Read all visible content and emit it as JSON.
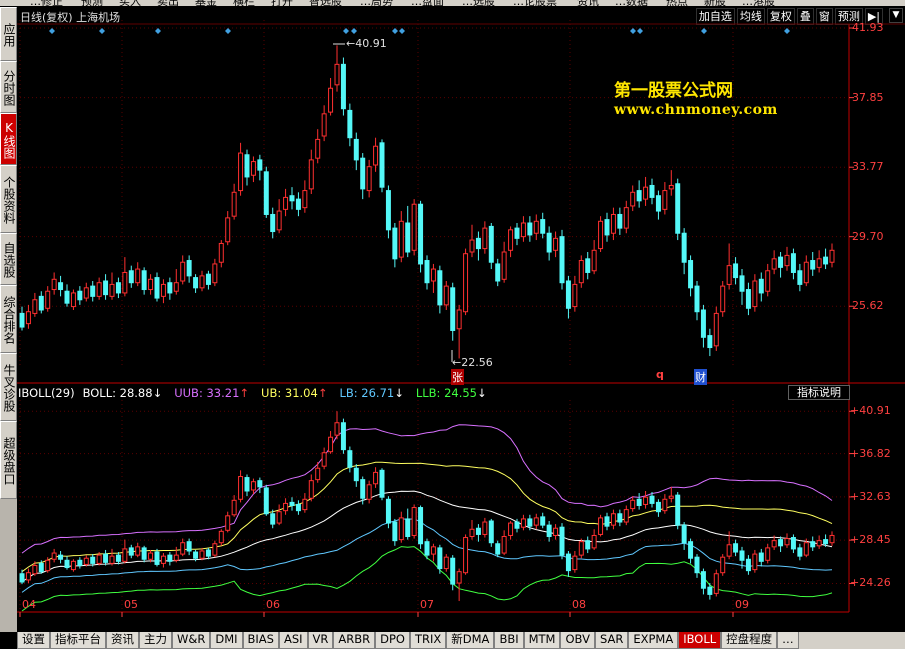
{
  "window": {
    "menu_fragments": [
      "…修正",
      "预测",
      "买入",
      "卖出",
      "基金",
      "横栏",
      "打开",
      "智选股",
      "…局势",
      "…盘面",
      "…选股",
      "…论股票",
      "资讯",
      "…数据",
      "热点",
      "新股",
      "…港股"
    ]
  },
  "left_nav": [
    {
      "label": "应用",
      "active": false
    },
    {
      "label": "分时图",
      "active": false
    },
    {
      "label": "K线图",
      "active": true
    },
    {
      "label": "个股资料",
      "active": false
    },
    {
      "label": "自选股",
      "active": false
    },
    {
      "label": "综合排名",
      "active": false
    },
    {
      "label": "牛叉诊股",
      "active": false
    },
    {
      "label": "超级盘口",
      "active": false
    }
  ],
  "header": {
    "title": "日线(复权) 上海机场",
    "buttons": [
      "加自选",
      "均线",
      "复权",
      "叠",
      "窗",
      "预测"
    ],
    "arrow_icon": "collapse-right-icon",
    "dropdown_icon": "chevron-down-icon"
  },
  "watermark": {
    "line1": "第一股票公式网",
    "line2": "www.chnmoney.com"
  },
  "price_axis": [
    "41.93",
    "37.85",
    "33.77",
    "29.70",
    "25.62"
  ],
  "indicator_axis": [
    "40.91",
    "36.82",
    "32.63",
    "28.45",
    "24.26"
  ],
  "time_axis": [
    "04",
    "05",
    "06",
    "07",
    "08",
    "09"
  ],
  "annotations": {
    "high_label": "40.91",
    "low_label": "22.56",
    "marker_zhang": "张",
    "marker_q": "q",
    "marker_cai": "财"
  },
  "indicator": {
    "name": "IBOLL(29)",
    "items": [
      {
        "label": "BOLL: 28.88",
        "arrow": "↓",
        "color": "#ffffff",
        "arrow_color": "#ffffff"
      },
      {
        "label": "UUB: 33.21",
        "arrow": "↑",
        "color": "#d870ff",
        "arrow_color": "#ff4040"
      },
      {
        "label": "UB: 31.04",
        "arrow": "↑",
        "color": "#ffff60",
        "arrow_color": "#ff4040"
      },
      {
        "label": "LB: 26.71",
        "arrow": "↓",
        "color": "#60c8ff",
        "arrow_color": "#ffffff"
      },
      {
        "label": "LLB: 24.55",
        "arrow": "↓",
        "color": "#40ff40",
        "arrow_color": "#ffffff"
      }
    ],
    "help_button": "指标说明"
  },
  "tabs": [
    {
      "label": "设置",
      "active": false
    },
    {
      "label": "指标平台",
      "active": false
    },
    {
      "label": "资讯",
      "active": false
    },
    {
      "label": "主力",
      "active": false
    },
    {
      "label": "W&R",
      "active": false
    },
    {
      "label": "DMI",
      "active": false
    },
    {
      "label": "BIAS",
      "active": false
    },
    {
      "label": "ASI",
      "active": false
    },
    {
      "label": "VR",
      "active": false
    },
    {
      "label": "ARBR",
      "active": false
    },
    {
      "label": "DPO",
      "active": false
    },
    {
      "label": "TRIX",
      "active": false
    },
    {
      "label": "新DMA",
      "active": false
    },
    {
      "label": "BBI",
      "active": false
    },
    {
      "label": "MTM",
      "active": false
    },
    {
      "label": "OBV",
      "active": false
    },
    {
      "label": "SAR",
      "active": false
    },
    {
      "label": "EXPMA",
      "active": false
    },
    {
      "label": "IBOLL",
      "active": true
    },
    {
      "label": "控盘程度",
      "active": false
    },
    {
      "label": "…",
      "active": false
    }
  ],
  "chart_data": {
    "type": "candlestick",
    "title": "日线(复权) 上海机场",
    "y_range_upper": [
      22.0,
      42.4
    ],
    "y_range_lower": [
      21.5,
      42.0
    ],
    "x_labels": [
      "04",
      "05",
      "06",
      "07",
      "08",
      "09"
    ],
    "candles": [
      [
        25.2,
        24.4,
        25.6,
        24.2
      ],
      [
        24.6,
        25.3,
        25.7,
        24.3
      ],
      [
        25.2,
        26.0,
        26.4,
        25.0
      ],
      [
        26.2,
        25.4,
        26.5,
        25.2
      ],
      [
        25.5,
        26.5,
        26.8,
        25.3
      ],
      [
        26.6,
        27.2,
        27.6,
        26.3
      ],
      [
        27.0,
        26.6,
        27.4,
        26.2
      ],
      [
        26.5,
        25.8,
        26.9,
        25.6
      ],
      [
        25.6,
        26.4,
        26.6,
        25.4
      ],
      [
        26.5,
        26.0,
        26.8,
        25.7
      ],
      [
        26.1,
        26.7,
        27.0,
        25.9
      ],
      [
        26.8,
        26.2,
        27.1,
        25.9
      ],
      [
        26.2,
        27.0,
        27.3,
        26.0
      ],
      [
        27.1,
        26.3,
        27.5,
        26.0
      ],
      [
        26.2,
        26.9,
        27.6,
        26.0
      ],
      [
        27.0,
        26.4,
        27.3,
        26.1
      ],
      [
        26.4,
        27.6,
        28.5,
        26.2
      ],
      [
        27.7,
        27.0,
        28.0,
        26.7
      ],
      [
        27.0,
        27.8,
        28.2,
        26.8
      ],
      [
        27.7,
        26.6,
        27.9,
        26.3
      ],
      [
        26.6,
        27.2,
        27.5,
        26.3
      ],
      [
        27.3,
        26.1,
        27.6,
        25.9
      ],
      [
        26.2,
        26.9,
        27.2,
        25.8
      ],
      [
        27.0,
        26.4,
        27.3,
        26.0
      ],
      [
        26.5,
        27.0,
        27.8,
        26.3
      ],
      [
        27.1,
        28.2,
        28.6,
        26.9
      ],
      [
        28.3,
        27.4,
        28.6,
        27.0
      ],
      [
        27.3,
        26.7,
        27.5,
        26.4
      ],
      [
        26.7,
        27.4,
        27.7,
        26.5
      ],
      [
        27.5,
        26.9,
        27.7,
        26.6
      ],
      [
        27.0,
        28.1,
        28.4,
        26.8
      ],
      [
        28.2,
        29.3,
        29.5,
        27.9
      ],
      [
        29.4,
        30.8,
        31.2,
        29.2
      ],
      [
        30.9,
        32.3,
        32.8,
        30.7
      ],
      [
        32.4,
        34.6,
        35.2,
        32.1
      ],
      [
        34.5,
        33.2,
        34.8,
        32.7
      ],
      [
        33.3,
        34.1,
        34.4,
        32.9
      ],
      [
        34.2,
        33.6,
        34.5,
        33.0
      ],
      [
        33.5,
        31.0,
        33.8,
        30.8
      ],
      [
        31.0,
        30.0,
        31.4,
        29.6
      ],
      [
        30.1,
        31.2,
        31.9,
        29.9
      ],
      [
        31.3,
        32.0,
        32.5,
        30.9
      ],
      [
        32.1,
        31.8,
        32.6,
        31.3
      ],
      [
        31.9,
        31.3,
        32.3,
        30.9
      ],
      [
        31.4,
        32.4,
        33.0,
        31.1
      ],
      [
        32.5,
        34.2,
        34.8,
        32.2
      ],
      [
        34.3,
        35.4,
        36.0,
        34.0
      ],
      [
        35.6,
        36.9,
        37.4,
        35.3
      ],
      [
        37.0,
        38.4,
        39.0,
        36.8
      ],
      [
        38.6,
        39.8,
        40.91,
        38.2
      ],
      [
        39.8,
        37.2,
        40.2,
        36.8
      ],
      [
        37.1,
        35.5,
        37.5,
        35.0
      ],
      [
        35.4,
        34.2,
        35.8,
        33.6
      ],
      [
        34.3,
        32.5,
        34.6,
        31.9
      ],
      [
        32.4,
        33.8,
        34.2,
        32.0
      ],
      [
        33.9,
        35.0,
        35.5,
        33.5
      ],
      [
        35.2,
        32.6,
        35.4,
        32.3
      ],
      [
        32.4,
        30.1,
        32.7,
        29.6
      ],
      [
        30.2,
        28.4,
        30.5,
        27.9
      ],
      [
        28.5,
        30.6,
        31.2,
        28.2
      ],
      [
        30.5,
        28.8,
        31.5,
        28.5
      ],
      [
        28.9,
        31.6,
        31.9,
        28.6
      ],
      [
        31.6,
        28.1,
        31.8,
        27.6
      ],
      [
        28.3,
        27.0,
        28.6,
        26.6
      ],
      [
        27.1,
        27.8,
        28.1,
        26.4
      ],
      [
        27.7,
        25.7,
        28.0,
        25.2
      ],
      [
        25.7,
        26.8,
        27.1,
        25.4
      ],
      [
        26.7,
        24.2,
        27.0,
        23.6
      ],
      [
        24.3,
        25.4,
        25.7,
        22.56
      ],
      [
        25.3,
        28.7,
        29.0,
        25.1
      ],
      [
        28.8,
        29.5,
        30.4,
        28.5
      ],
      [
        29.6,
        29.0,
        30.0,
        28.3
      ],
      [
        29.0,
        30.2,
        30.6,
        28.7
      ],
      [
        30.3,
        28.2,
        30.5,
        27.8
      ],
      [
        28.1,
        27.1,
        28.4,
        26.8
      ],
      [
        27.2,
        28.8,
        29.4,
        27.0
      ],
      [
        28.9,
        30.1,
        30.3,
        28.5
      ],
      [
        30.2,
        29.6,
        30.5,
        29.2
      ],
      [
        29.7,
        30.5,
        30.9,
        29.4
      ],
      [
        30.5,
        29.8,
        30.9,
        29.4
      ],
      [
        29.9,
        30.6,
        31.0,
        29.5
      ],
      [
        30.7,
        29.9,
        31.1,
        29.6
      ],
      [
        29.9,
        28.8,
        30.3,
        28.3
      ],
      [
        28.9,
        29.6,
        30.0,
        28.5
      ],
      [
        29.7,
        27.0,
        30.1,
        26.6
      ],
      [
        27.1,
        25.5,
        27.4,
        24.9
      ],
      [
        25.6,
        26.9,
        27.4,
        25.3
      ],
      [
        27.0,
        28.3,
        28.6,
        26.7
      ],
      [
        28.4,
        27.6,
        28.8,
        27.2
      ],
      [
        27.7,
        28.9,
        29.5,
        27.5
      ],
      [
        29.0,
        30.6,
        30.9,
        28.8
      ],
      [
        30.7,
        29.8,
        31.1,
        29.4
      ],
      [
        29.9,
        31.0,
        31.4,
        29.5
      ],
      [
        31.0,
        30.2,
        31.4,
        29.8
      ],
      [
        30.2,
        31.4,
        31.8,
        29.9
      ],
      [
        31.5,
        32.3,
        32.7,
        31.2
      ],
      [
        32.4,
        31.8,
        33.0,
        31.4
      ],
      [
        31.9,
        32.6,
        33.2,
        31.5
      ],
      [
        32.7,
        32.0,
        33.1,
        31.6
      ],
      [
        32.1,
        31.2,
        32.4,
        30.7
      ],
      [
        31.3,
        32.4,
        32.9,
        31.0
      ],
      [
        32.5,
        32.7,
        33.6,
        32.1
      ],
      [
        32.8,
        29.9,
        33.1,
        29.5
      ],
      [
        29.9,
        28.2,
        30.2,
        27.5
      ],
      [
        28.3,
        26.7,
        28.6,
        26.2
      ],
      [
        26.8,
        25.3,
        27.1,
        24.8
      ],
      [
        25.4,
        23.8,
        25.7,
        23.2
      ],
      [
        23.9,
        23.2,
        24.3,
        22.7
      ],
      [
        23.3,
        25.2,
        25.6,
        23.0
      ],
      [
        25.3,
        26.8,
        27.1,
        25.0
      ],
      [
        26.9,
        28.0,
        29.3,
        26.6
      ],
      [
        28.1,
        27.3,
        28.5,
        26.9
      ],
      [
        27.4,
        26.5,
        27.8,
        25.7
      ],
      [
        26.6,
        25.5,
        27.0,
        25.1
      ],
      [
        25.6,
        27.1,
        27.5,
        25.3
      ],
      [
        27.2,
        26.4,
        27.6,
        25.9
      ],
      [
        26.5,
        27.7,
        28.1,
        26.2
      ],
      [
        27.8,
        28.4,
        28.9,
        27.5
      ],
      [
        28.5,
        27.9,
        28.8,
        27.3
      ],
      [
        28.0,
        28.6,
        29.1,
        27.7
      ],
      [
        28.7,
        27.6,
        29.0,
        27.2
      ],
      [
        27.7,
        26.9,
        28.1,
        26.5
      ],
      [
        27.0,
        28.2,
        28.6,
        26.8
      ],
      [
        28.3,
        27.8,
        28.8,
        27.4
      ],
      [
        27.9,
        28.4,
        28.9,
        27.6
      ],
      [
        28.5,
        28.1,
        29.0,
        27.8
      ],
      [
        28.2,
        28.9,
        29.3,
        27.9
      ]
    ],
    "boll_series": [
      "BOLL",
      "UUB",
      "UB",
      "LB",
      "LLB"
    ],
    "boll_colors": {
      "BOLL": "#ffffff",
      "UUB": "#d870ff",
      "UB": "#ffff60",
      "LB": "#60c8ff",
      "LLB": "#40ff40"
    }
  }
}
